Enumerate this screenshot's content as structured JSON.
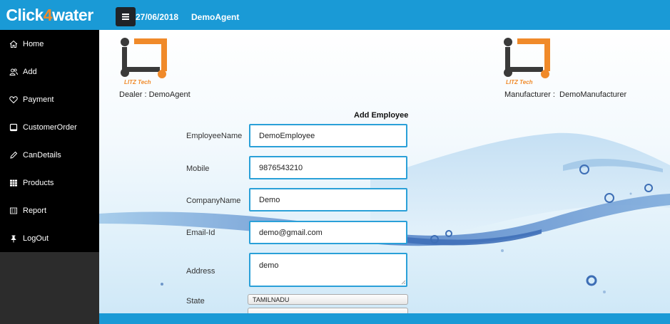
{
  "header": {
    "brand_part1": "Click",
    "brand_part2": "4",
    "brand_part3": "water",
    "date": "27/06/2018",
    "agent": "DemoAgent",
    "menu_icon": "hamburger-icon"
  },
  "sidebar": {
    "items": [
      {
        "label": "Home",
        "icon": "home-icon"
      },
      {
        "label": "Add",
        "icon": "users-icon"
      },
      {
        "label": "Payment",
        "icon": "heart-icon"
      },
      {
        "label": "CustomerOrder",
        "icon": "tablet-icon"
      },
      {
        "label": "CanDetails",
        "icon": "pencil-icon"
      },
      {
        "label": "Products",
        "icon": "grid-icon"
      },
      {
        "label": "Report",
        "icon": "report-icon"
      },
      {
        "label": "LogOut",
        "icon": "pin-icon"
      }
    ]
  },
  "logos": {
    "left_text": "LITZ Tech",
    "right_text": "LITZ Tech"
  },
  "dealer": "Dealer : DemoAgent",
  "manufacturer": "Manufacturer :  DemoManufacturer",
  "form": {
    "title": "Add Employee",
    "employee_name_label": "EmployeeName",
    "employee_name_value": "DemoEmployee",
    "mobile_label": "Mobile",
    "mobile_value": "9876543210",
    "company_label": "CompanyName",
    "company_value": "Demo",
    "email_label": "Email-Id",
    "email_value": "demo@gmail.com",
    "address_label": "Address",
    "address_value": "demo",
    "state_label": "State",
    "state_value": "TAMILNADU"
  },
  "colors": {
    "accent": "#1a9ad6",
    "brand_orange": "#f08a2a",
    "sidebar_bg": "#000000",
    "input_border": "#2aa0d8"
  }
}
